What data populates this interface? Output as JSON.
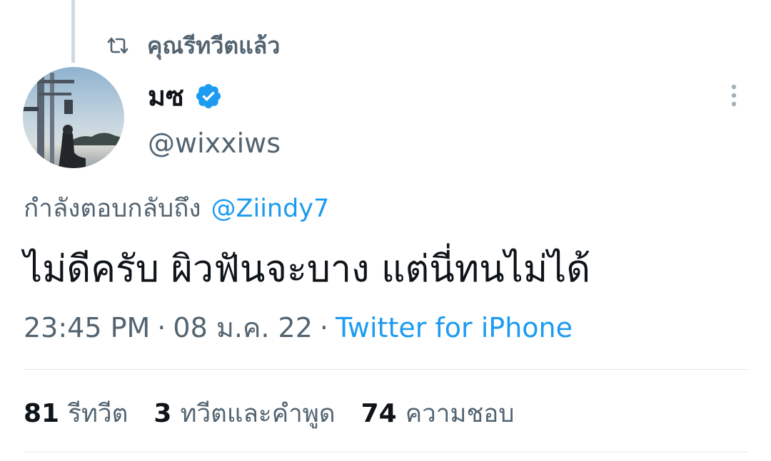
{
  "social_context": {
    "label": "คุณรีทวีตแล้ว",
    "icon": "retweet-icon"
  },
  "author": {
    "display_name": "มซ",
    "handle": "@wixxiws",
    "verified": true,
    "verified_color": "#1d9bf0",
    "avatar_icon": "avatar-photo"
  },
  "more_icon": "more-vertical-icon",
  "tweet": {
    "reply_prefix": "กำลังตอบกลับถึง",
    "reply_to": "@Ziindy7",
    "text": "ไม่ดีครับ ผิวฟันจะบาง  แต่นี่ทนไม่ได้",
    "time": "23:45 PM",
    "separator": "·",
    "date": "08 ม.ค. 22",
    "source": "Twitter for iPhone"
  },
  "stats": {
    "retweets": {
      "count": "81",
      "label": "รีทวีต"
    },
    "quotes": {
      "count": "3",
      "label": "ทวีตและคำพูด"
    },
    "likes": {
      "count": "74",
      "label": "ความชอบ"
    }
  },
  "colors": {
    "text_primary": "#0f1419",
    "text_secondary": "#536471",
    "link": "#1d9bf0",
    "divider": "#e1e8ed"
  }
}
